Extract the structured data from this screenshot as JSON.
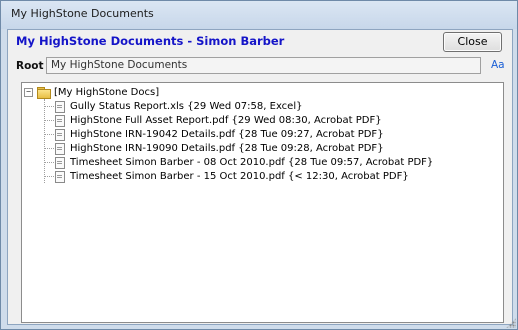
{
  "window": {
    "title": "My HighStone Documents"
  },
  "header": {
    "title": "My HighStone Documents - Simon Barber",
    "close_label": "Close"
  },
  "root": {
    "label": "Root",
    "value": "My HighStone Documents",
    "font_link": "Aa"
  },
  "tree": {
    "root_node": {
      "expander": "−",
      "label": "[My HighStone Docs]"
    },
    "files": [
      {
        "label": "Gully Status Report.xls  {29 Wed 07:58, Excel}"
      },
      {
        "label": "HighStone Full Asset Report.pdf  {29 Wed 08:30, Acrobat PDF}"
      },
      {
        "label": "HighStone IRN-19042 Details.pdf  {28 Tue 09:27, Acrobat PDF}"
      },
      {
        "label": "HighStone IRN-19090 Details.pdf  {28 Tue 09:28, Acrobat PDF}"
      },
      {
        "label": "Timesheet Simon Barber - 08 Oct 2010.pdf  {28 Tue 09:57, Acrobat PDF}"
      },
      {
        "label": "Timesheet Simon Barber - 15 Oct 2010.pdf  {< 12:30, Acrobat PDF}"
      }
    ]
  },
  "colors": {
    "header_title": "#1414c8",
    "link": "#1a5fd6",
    "frame": "#cfdceb"
  },
  "icons": {
    "folder": "folder-icon",
    "file": "file-icon",
    "grip": "resize-grip-icon"
  }
}
